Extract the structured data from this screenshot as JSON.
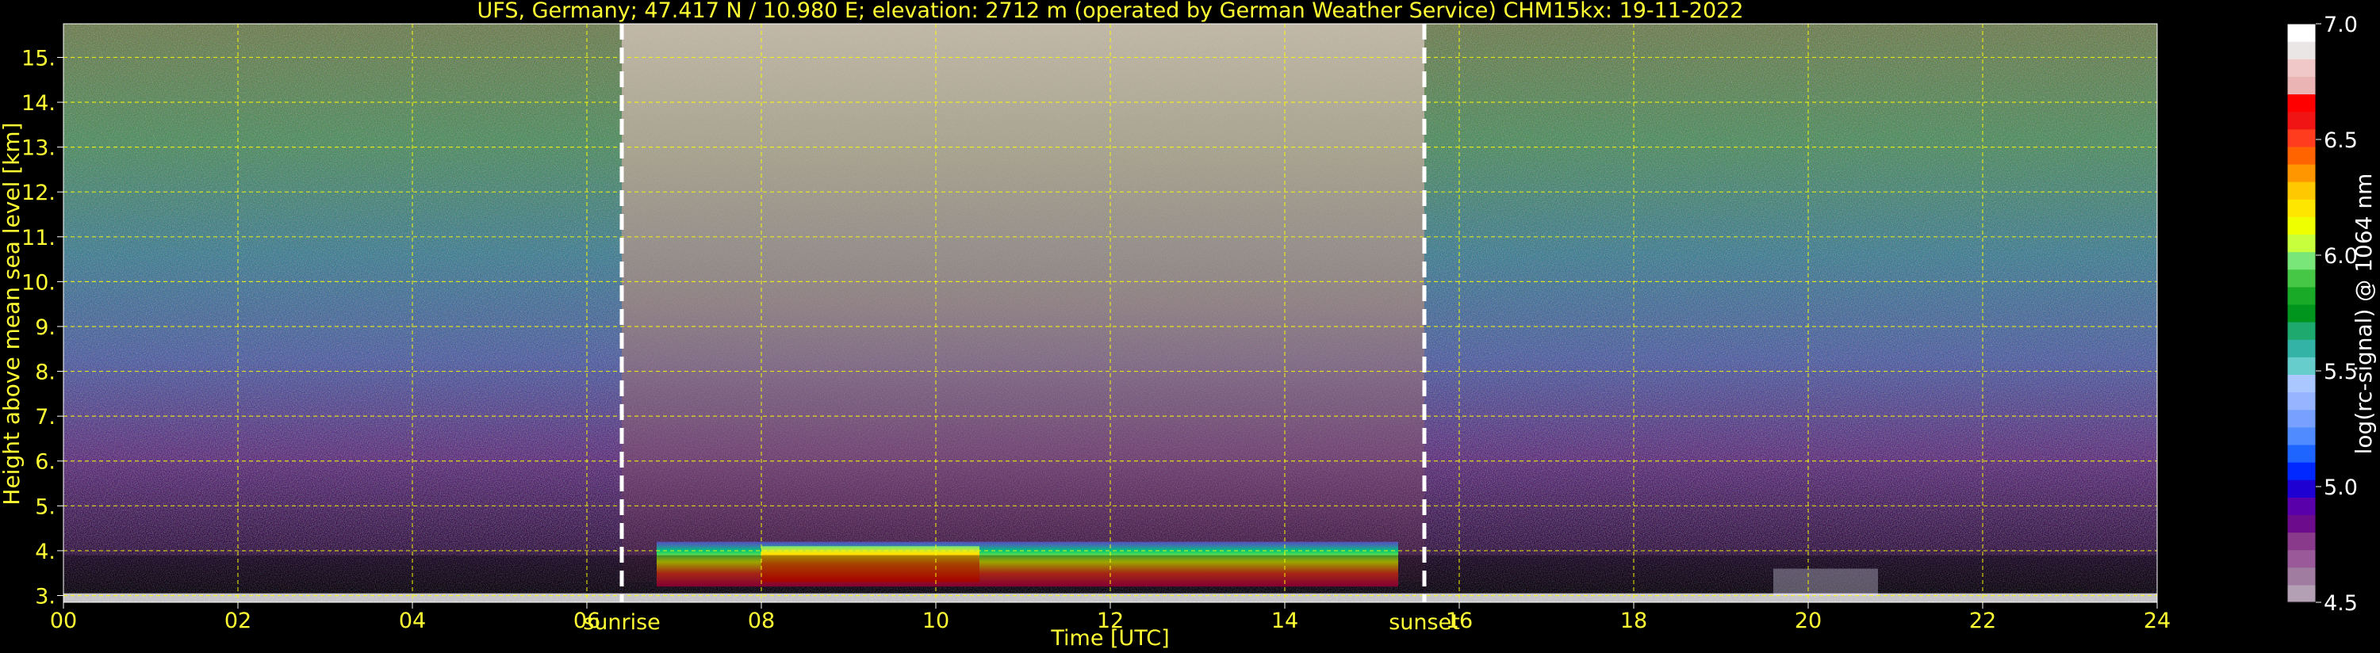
{
  "chart_data": {
    "type": "heatmap",
    "title": "UFS, Germany; 47.417 N / 10.980 E; elevation: 2712 m  (operated by German Weather Service)    CHM15kx: 19-11-2022",
    "xlabel": "Time [UTC]",
    "ylabel": "Height above mean sea level [km]",
    "xlim": [
      0,
      24
    ],
    "ylim": [
      2.85,
      15.75
    ],
    "x_ticks": [
      "00",
      "02",
      "04",
      "06",
      "08",
      "10",
      "12",
      "14",
      "16",
      "18",
      "20",
      "22",
      "24"
    ],
    "y_ticks": [
      "3.",
      "4.",
      "5.",
      "6.",
      "7.",
      "8.",
      "9.",
      "10.",
      "11.",
      "12.",
      "13.",
      "14.",
      "15."
    ],
    "grid": true,
    "grid_color": "#ffff00",
    "annotations": [
      {
        "label": "sunrise",
        "x": 6.4
      },
      {
        "label": "sunset",
        "x": 15.6
      }
    ],
    "colorbar": {
      "label": "log(rc-signal) @ 1064 nm",
      "range": [
        4.5,
        7.0
      ],
      "ticks": [
        "4.5",
        "5.0",
        "5.5",
        "6.0",
        "6.5",
        "7.0"
      ],
      "colors": [
        "#b4a0b4",
        "#a07da0",
        "#9a5a9a",
        "#8a3a8a",
        "#6c0c8c",
        "#5a00aa",
        "#1e00d2",
        "#0028ff",
        "#1e64ff",
        "#508cff",
        "#78a0ff",
        "#96b4ff",
        "#aac8ff",
        "#66cccc",
        "#33b3a6",
        "#1eaa6e",
        "#00961e",
        "#19aa28",
        "#46c846",
        "#78e678",
        "#c8ff3c",
        "#f0ff00",
        "#ffe600",
        "#ffc800",
        "#ff9600",
        "#ff6400",
        "#ff3c1e",
        "#f01414",
        "#ff0000",
        "#ebb4b4",
        "#f0c8c8",
        "#ebe6e6",
        "#ffffff"
      ]
    },
    "features": [
      {
        "name": "ground-signal",
        "t_start": 0,
        "t_end": 24,
        "h_base": 2.85,
        "h_top": 3.05
      },
      {
        "name": "daytime-noise",
        "t_start": 6.4,
        "t_end": 15.6,
        "h_base": 3.3,
        "h_top": 15.75
      },
      {
        "name": "boundary-layer-aerosol",
        "t_start": 6.8,
        "t_end": 15.3,
        "h_base": 3.2,
        "h_top": 4.2
      },
      {
        "name": "strong-aerosol-layer",
        "t_start": 8.0,
        "t_end": 10.5,
        "h_base": 3.3,
        "h_top": 4.1
      },
      {
        "name": "evening-clutter",
        "t_start": 19.6,
        "t_end": 20.8,
        "h_base": 3.0,
        "h_top": 3.6
      }
    ]
  }
}
